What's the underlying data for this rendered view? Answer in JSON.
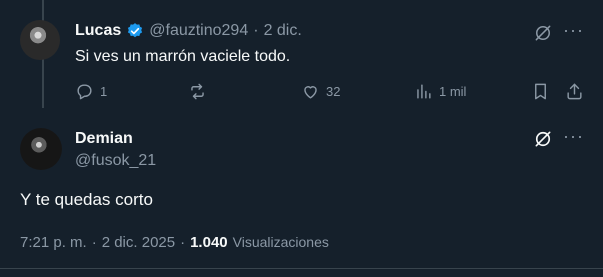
{
  "tweet1": {
    "name": "Lucas",
    "handle": "@fauztino294",
    "separator": "·",
    "date": "2 dic.",
    "text": "Si ves un marrón vaciele todo.",
    "replies": "1",
    "likes": "32",
    "views": "1 mil"
  },
  "tweet2": {
    "name": "Demian",
    "handle": "@fusok_21",
    "text": "Y te quedas corto",
    "time": "7:21 p. m.",
    "separator": "·",
    "date": "2 dic. 2025",
    "views_count": "1.040",
    "views_label": "Visualizaciones"
  },
  "colors": {
    "background": "#15202b",
    "accent": "#1d9bf0",
    "muted": "#8b98a5",
    "text": "#f7f9f9",
    "divider": "#38444d"
  },
  "icons": [
    "verified-badge-icon",
    "grok-icon",
    "more-icon",
    "reply-icon",
    "retweet-icon",
    "like-icon",
    "views-icon",
    "bookmark-icon",
    "share-icon"
  ]
}
